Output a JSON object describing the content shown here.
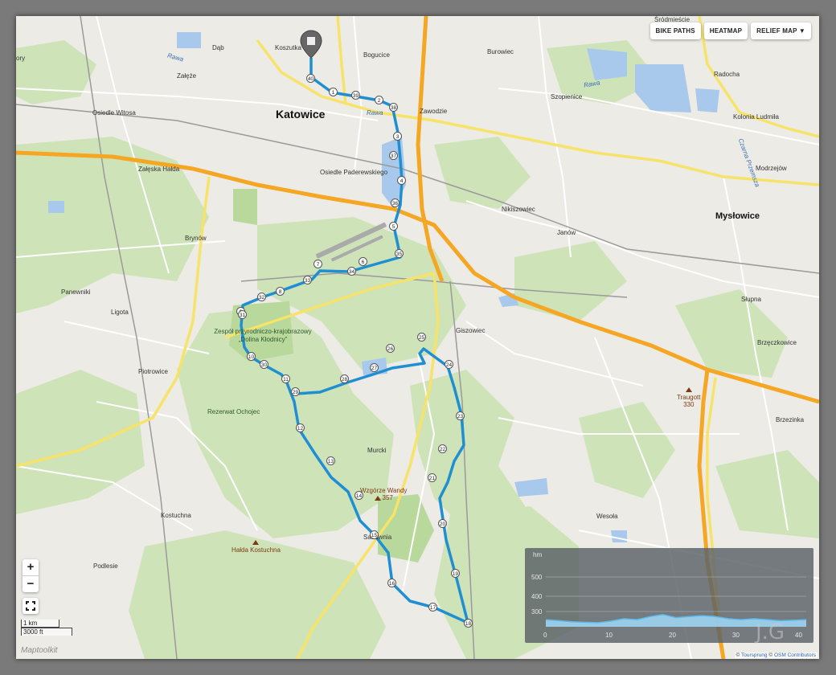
{
  "map": {
    "toolbar": {
      "bike_paths": "BIKE PATHS",
      "heatmap": "HEATMAP",
      "relief_map": "RELIEF MAP ▼"
    },
    "zoom": {
      "in": "+",
      "out": "−"
    },
    "scale": {
      "metric": "1 km",
      "imperial": "3000 ft"
    },
    "brand": "Maptoolkit",
    "attribution": {
      "prefix": "©",
      "source1": "Toursprung",
      "sep": " © ",
      "source2": "OSM Contributors"
    },
    "watermark": "J.G",
    "labels": {
      "katowice": "Katowice",
      "myslowice": "Mysłowice",
      "srodmiescie": "Śródmieście",
      "dab": "Dąb",
      "koszutka": "Koszutka",
      "bogucice": "Bogucice",
      "burowiec": "Burowiec",
      "zaleze": "Załęże",
      "szopienice": "Szopienice",
      "radocha": "Radocha",
      "osiedle_witosa": "Osiedle Witosa",
      "zawodzie": "Zawodzie",
      "kolonia_ludmila": "Kolonia Ludmiła",
      "zaleska_halda": "Załęska Hałda",
      "osiedle_paderewskiego": "Osiedle Paderewskiego",
      "modrzejow": "Modrzejów",
      "nikiszowiec": "Nikiszowiec",
      "janow": "Janów",
      "brynow": "Brynów",
      "panewniki": "Panewniki",
      "ligota": "Ligota",
      "slupna": "Słupna",
      "giszowiec": "Giszowiec",
      "brzeczkowice": "Brzęczkowice",
      "zespol": "Zespół przyrodniczo-krajobrazowy „Dolina Kłodnicy”",
      "piotrowice": "Piotrowice",
      "traugott": "Traugott",
      "traugott_ele": "330",
      "rezerwat": "Rezerwat Ochojec",
      "brzezinka": "Brzezinka",
      "murcki": "Murcki",
      "wzgorze": "Wzgórze Wandy",
      "wzgorze_ele": "357",
      "kostuchna": "Kostuchna",
      "wesola": "Wesoła",
      "halda_kostuchna": "Hałda Kostuchna",
      "sadownia": "Sadownia",
      "podlesie": "Podlesie",
      "rawa": "Rawa",
      "rawa2": "Rawa",
      "rawa3": "Rawa",
      "czarna_przemsza": "Czarna Przemsza",
      "ory": "ory"
    },
    "waypoints": [
      "1",
      "2",
      "3",
      "4",
      "5",
      "6",
      "7",
      "8",
      "9",
      "10",
      "11",
      "12",
      "13",
      "14",
      "15",
      "16",
      "17",
      "18",
      "19",
      "20",
      "21",
      "22",
      "23",
      "24",
      "25",
      "26",
      "27",
      "28",
      "29",
      "30",
      "31",
      "32",
      "33",
      "34",
      "35",
      "36",
      "37",
      "38",
      "39",
      "40"
    ],
    "colors": {
      "route": "#1f8fd1",
      "motorway": "#f5a623",
      "primary": "#f7e36a",
      "forest": "#cfe3b9",
      "water": "#a9c9ec"
    }
  },
  "elevation_profile": {
    "unit": "hm",
    "y_ticks": [
      "500",
      "400",
      "300"
    ],
    "x_ticks": [
      "0",
      "10",
      "20",
      "30",
      "40"
    ],
    "chart_data": {
      "type": "area",
      "xlabel": "",
      "ylabel": "hm",
      "ylim": [
        250,
        550
      ],
      "xlim": [
        0,
        40
      ],
      "x": [
        0,
        2,
        4,
        6,
        8,
        10,
        12,
        14,
        16,
        18,
        20,
        22,
        24,
        26,
        28,
        30,
        32,
        34,
        36,
        38,
        40
      ],
      "series": [
        {
          "values": [
            285,
            280,
            275,
            272,
            270,
            278,
            290,
            285,
            300,
            310,
            295,
            300,
            305,
            300,
            290,
            285,
            290,
            285,
            280,
            282,
            285
          ]
        }
      ]
    }
  }
}
